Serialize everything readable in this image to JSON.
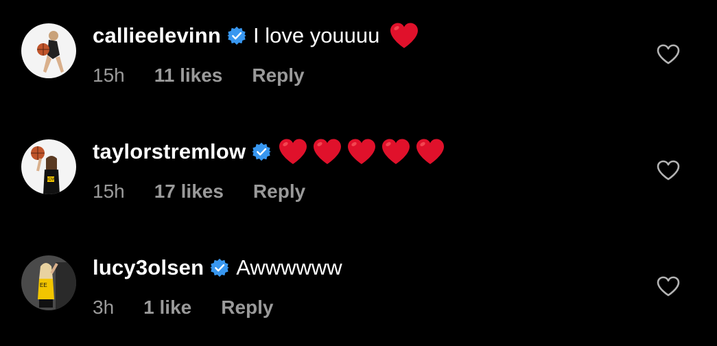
{
  "comments": [
    {
      "username": "callieelevinn",
      "text": "I love youuuu",
      "heart_emoji_count": 1,
      "time": "15h",
      "likes": "11 likes",
      "reply": "Reply"
    },
    {
      "username": "taylorstremlow",
      "text": "",
      "heart_emoji_count": 5,
      "time": "15h",
      "likes": "17 likes",
      "reply": "Reply"
    },
    {
      "username": "lucy3olsen",
      "text": "Awwwwww",
      "heart_emoji_count": 0,
      "time": "3h",
      "likes": "1 like",
      "reply": "Reply"
    }
  ],
  "colors": {
    "background": "#000000",
    "primary_text": "#ffffff",
    "secondary_text": "#9a9a9a",
    "verified_badge": "#3897f0",
    "heart_emoji": "#e0112b"
  },
  "icons": {
    "verified": "verified-badge-icon",
    "heart_emoji": "red-heart-emoji-icon",
    "like": "heart-outline-icon"
  }
}
